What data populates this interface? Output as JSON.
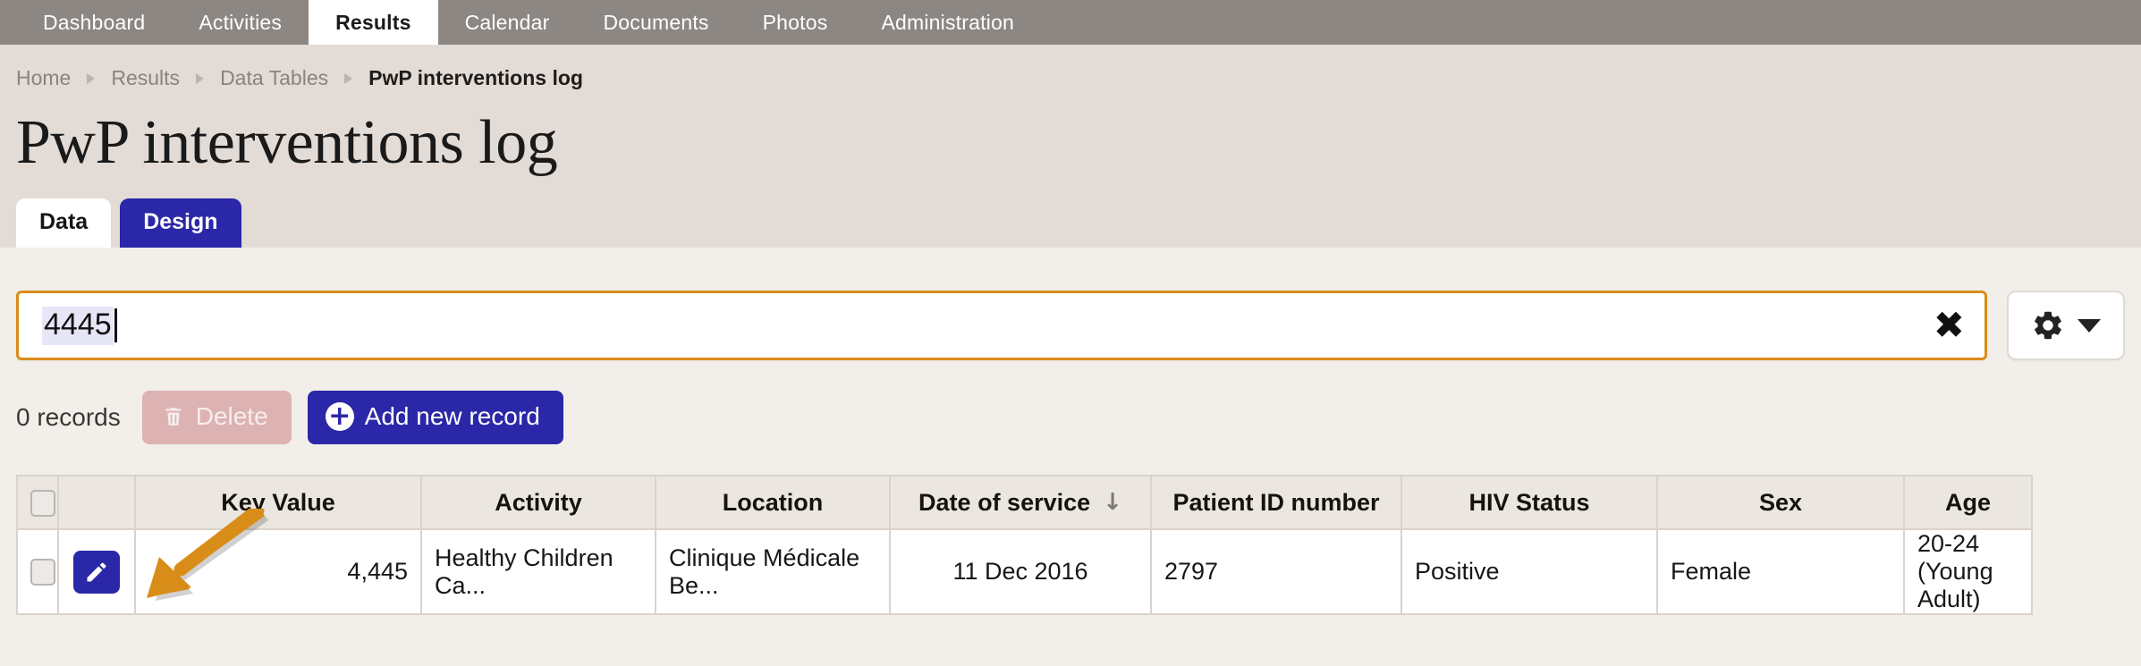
{
  "topnav": {
    "items": [
      {
        "label": "Dashboard",
        "active": false
      },
      {
        "label": "Activities",
        "active": false
      },
      {
        "label": "Results",
        "active": true
      },
      {
        "label": "Calendar",
        "active": false
      },
      {
        "label": "Documents",
        "active": false
      },
      {
        "label": "Photos",
        "active": false
      },
      {
        "label": "Administration",
        "active": false
      }
    ]
  },
  "breadcrumb": {
    "items": [
      "Home",
      "Results",
      "Data Tables",
      "PwP interventions log"
    ]
  },
  "header": {
    "title": "PwP interventions log"
  },
  "tabs": [
    {
      "label": "Data",
      "active": true
    },
    {
      "label": "Design",
      "active": false
    }
  ],
  "search": {
    "value": "4445",
    "clear_icon": "close-x-icon",
    "settings_icon": "gear-icon",
    "dropdown_icon": "chevron-down-icon"
  },
  "actions": {
    "records_count_label": "0 records",
    "delete_label": "Delete",
    "delete_icon": "trash-icon",
    "add_label": "Add new record",
    "add_icon": "plus-circle-icon"
  },
  "table": {
    "columns": [
      {
        "key": "key_value",
        "label": "Key Value",
        "align": "right"
      },
      {
        "key": "activity",
        "label": "Activity",
        "align": "left"
      },
      {
        "key": "location",
        "label": "Location",
        "align": "left"
      },
      {
        "key": "date_of_service",
        "label": "Date of service",
        "align": "center",
        "sorted": "desc",
        "sort_icon": "arrow-down-icon"
      },
      {
        "key": "patient_id",
        "label": "Patient ID number",
        "align": "left"
      },
      {
        "key": "hiv_status",
        "label": "HIV Status",
        "align": "left"
      },
      {
        "key": "sex",
        "label": "Sex",
        "align": "left"
      },
      {
        "key": "age",
        "label": "Age",
        "align": "left"
      }
    ],
    "rows": [
      {
        "key_value": "4,445",
        "activity": "Healthy Children Ca...",
        "location": "Clinique Médicale Be...",
        "date_of_service": "11 Dec 2016",
        "patient_id": "2797",
        "hiv_status": "Positive",
        "sex": "Female",
        "age": "20-24 (Young Adult)"
      }
    ]
  },
  "annotation": {
    "arrow_icon": "arrow-pointer-icon",
    "color": "#d98d19"
  },
  "colors": {
    "nav_bg": "#8c8783",
    "header_bg": "#e2dbd6",
    "content_bg": "#f2efea",
    "accent_blue": "#2a27a8",
    "highlight_orange": "#d98d19",
    "delete_pink": "#ddb2b2"
  }
}
